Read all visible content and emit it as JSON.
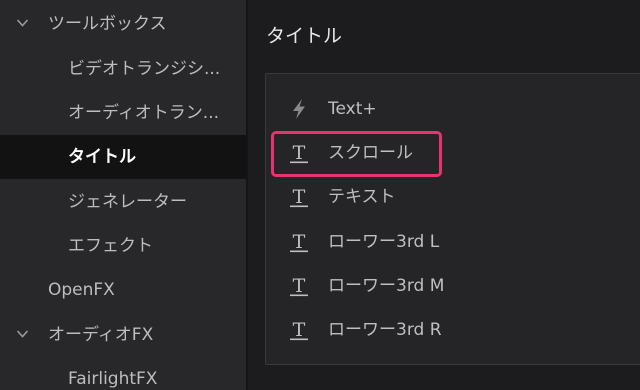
{
  "sidebar": {
    "items": [
      {
        "label": "ツールボックス",
        "expanded": true
      },
      {
        "label": "ビデオトランジシ..."
      },
      {
        "label": "オーディオトラン..."
      },
      {
        "label": "タイトル",
        "selected": true
      },
      {
        "label": "ジェネレーター"
      },
      {
        "label": "エフェクト"
      },
      {
        "label": "OpenFX"
      },
      {
        "label": "オーディオFX",
        "expanded": true
      },
      {
        "label": "FairlightFX"
      }
    ]
  },
  "main": {
    "title": "タイトル",
    "items": [
      {
        "label": "Text+",
        "icon": "lightning-icon"
      },
      {
        "label": "スクロール",
        "icon": "title-t-icon",
        "highlighted": true
      },
      {
        "label": "テキスト",
        "icon": "title-t-icon"
      },
      {
        "label": "ローワー3rd L",
        "icon": "title-t-icon"
      },
      {
        "label": "ローワー3rd M",
        "icon": "title-t-icon"
      },
      {
        "label": "ローワー3rd R",
        "icon": "title-t-icon"
      }
    ]
  },
  "colors": {
    "highlight": "#e8336e",
    "selected_row": "#121213",
    "sidebar_bg": "#28282a",
    "main_bg": "#1c1c1e"
  }
}
